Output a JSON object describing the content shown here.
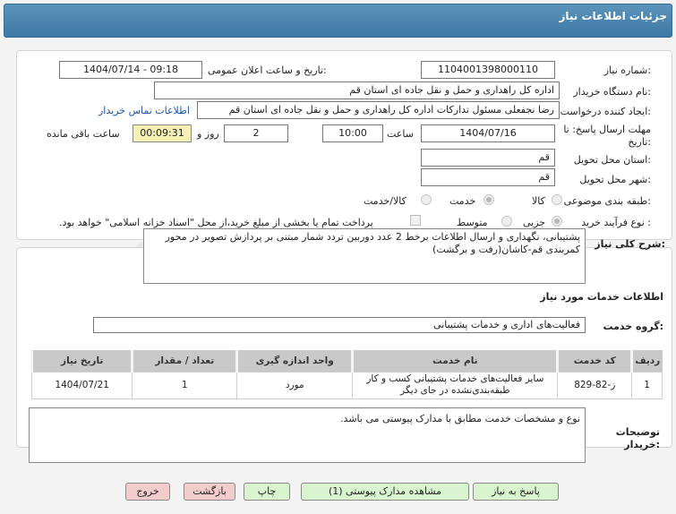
{
  "header": {
    "title": "جزئیات اطلاعات نیاز"
  },
  "form": {
    "need_number_label": "شماره نیاز:",
    "need_number": "1104001398000110",
    "announce_label": "تاریخ و ساعت اعلان عمومی:",
    "announce_value": "1404/07/14 - 09:18",
    "buyer_label": "نام دستگاه خریدار:",
    "buyer_value": "اداره کل راهداری و حمل و نقل جاده ای استان قم",
    "creator_label": "ایجاد کننده درخواست:",
    "creator_value": "رضا  نجفعلی مسئول تدارکات اداره کل راهداری و حمل و نقل جاده ای استان قم",
    "contact_link": "اطلاعات تماس خریدار",
    "deadline_label_1": "مهلت ارسال پاسخ: تا",
    "deadline_label_2": "تاریخ:",
    "deadline_date": "1404/07/16",
    "time_label": "ساعت",
    "deadline_time": "10:00",
    "days_value": "2",
    "days_label": "روز و",
    "timer_value": "00:09:31",
    "remaining_label": "ساعت باقی مانده",
    "province_label": "استان محل تحویل:",
    "province_value": "قم",
    "city_label": "شهر محل تحویل:",
    "city_value": "قم",
    "category_label": "طبقه بندی موضوعی:",
    "category_options": [
      "کالا",
      "خدمت",
      "کالا/خدمت"
    ],
    "process_label": "نوع فرآیند خرید :",
    "process_options": [
      "جزیی",
      "متوسط"
    ],
    "payment_note": "پرداخت تمام یا بخشی از مبلغ خرید،از محل \"اسناد خزانه اسلامی\" خواهد بود."
  },
  "desc": {
    "label": "شرح کلی نیاز:",
    "value": "پشتیبانی، نگهداری و ارسال اطلاعات برخط 2 عدد دوربین تردد شمار مبتنی بر پردازش تصویر در محور کمربندی قم-کاشان(رفت و برگشت)"
  },
  "services": {
    "title": "اطلاعات خدمات مورد نیاز",
    "group_label": "گروه خدمت:",
    "group_value": "فعالیت‌های اداری و خدمات پشتیبانی"
  },
  "table": {
    "headers": [
      "ردیف",
      "کد خدمت",
      "نام خدمت",
      "واحد اندازه گیری",
      "تعداد / مقدار",
      "تاریخ نیاز"
    ],
    "rows": [
      [
        "1",
        "ز-82-829",
        "سایر فعالیت‌های خدمات پشتیبانی کسب و کار طبقه‌بندی‌نشده در جای دیگر",
        "مورد",
        "1",
        "1404/07/21"
      ]
    ]
  },
  "buyer_notes": {
    "label_1": "توضیحات",
    "label_2": "خریدار:",
    "value": "نوع و مشخصات خدمت مطابق با مدارک پیوستی می باشد."
  },
  "buttons": {
    "reply": "پاسخ به نیاز",
    "attachments": "مشاهده مدارک پیوستی (1)",
    "print": "چاپ",
    "back": "بازگشت",
    "exit": "خروج"
  },
  "colors": {
    "header_bg": "#4a86b0",
    "timer_bg": "#f6f0b4",
    "green_button": "#d9f5d0",
    "pink_button": "#f3cccc",
    "link": "#1a55b0"
  }
}
